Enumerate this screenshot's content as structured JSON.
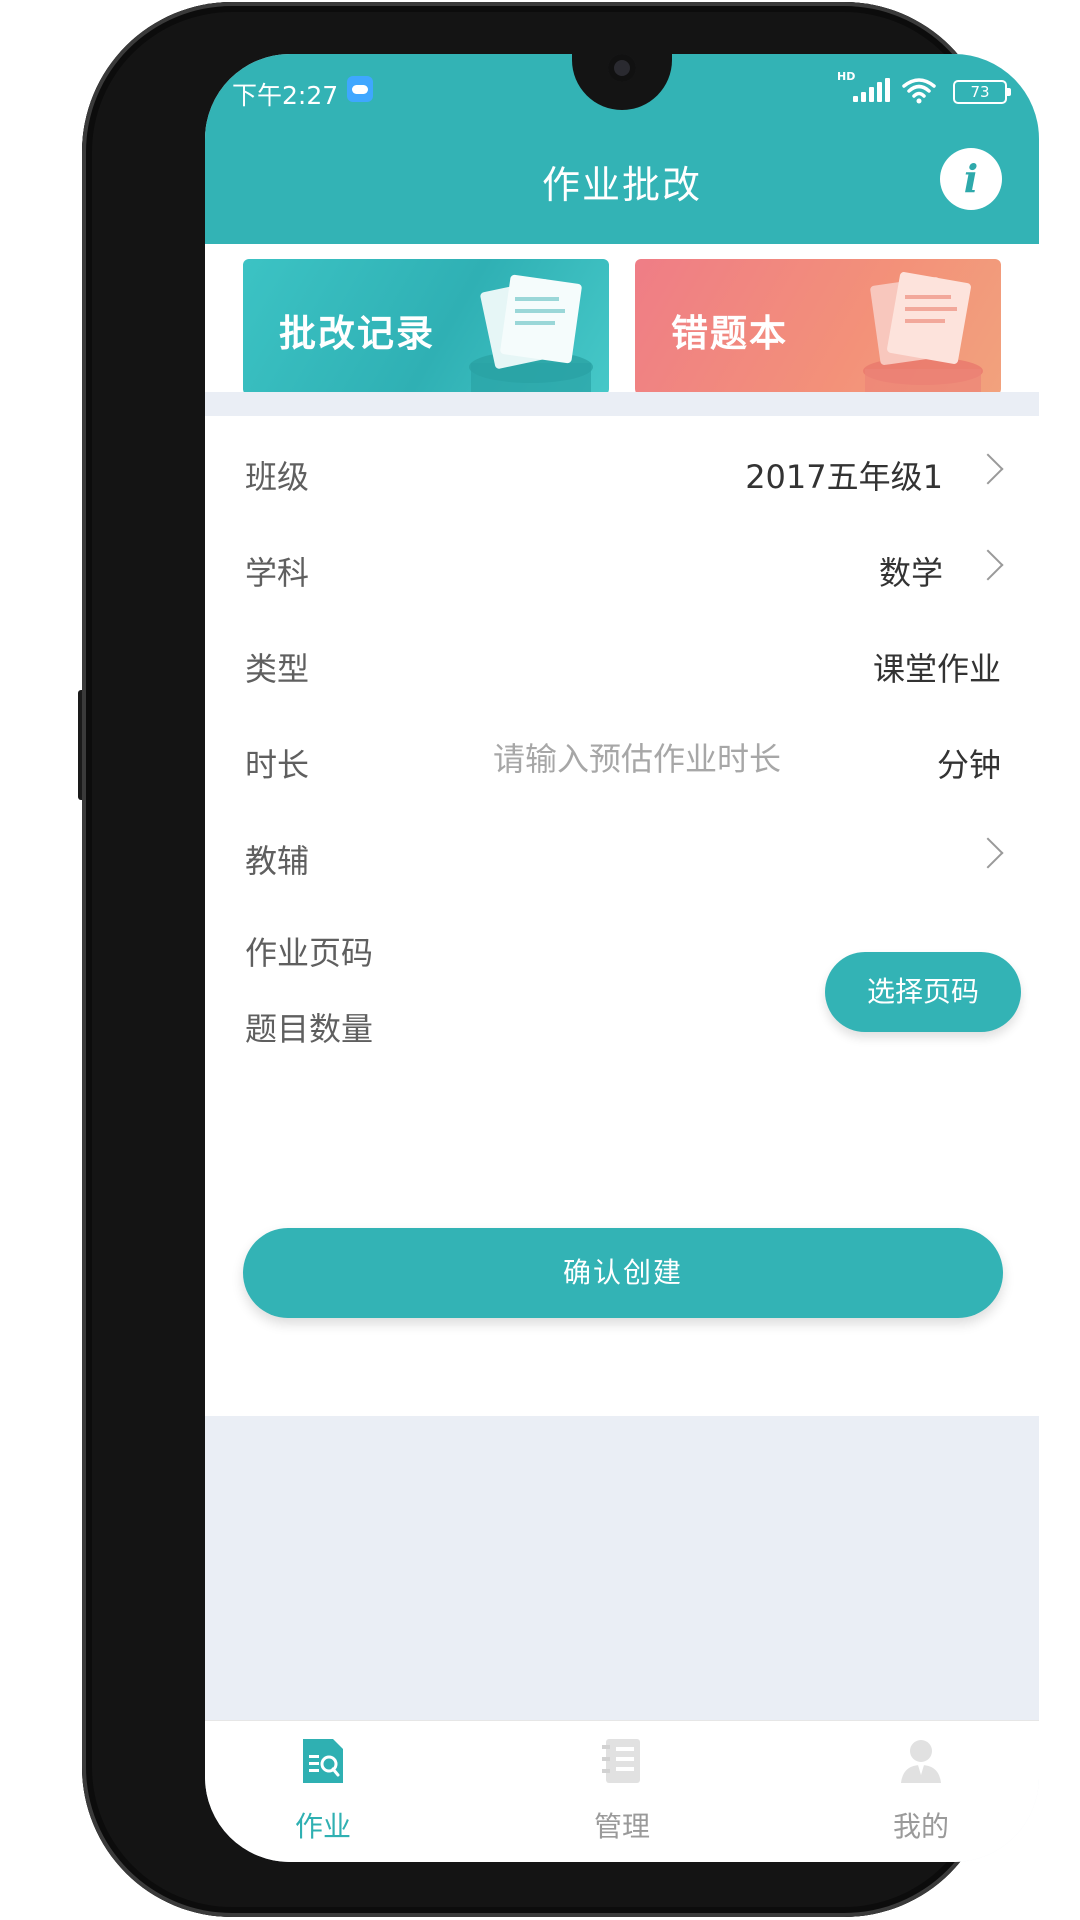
{
  "status_bar": {
    "time": "下午2:27",
    "battery": "73",
    "network_badge": "HD"
  },
  "header": {
    "title": "作业批改",
    "info_symbol": "i"
  },
  "banners": {
    "records_label": "批改记录",
    "mistakes_label": "错题本"
  },
  "form": {
    "class_label": "班级",
    "class_value": "2017五年级1",
    "subject_label": "学科",
    "subject_value": "数学",
    "type_label": "类型",
    "type_value": "课堂作业",
    "duration_label": "时长",
    "duration_placeholder": "请输入预估作业时长",
    "duration_value": "",
    "duration_unit": "分钟",
    "material_label": "教辅",
    "pages_label": "作业页码",
    "count_label": "题目数量",
    "select_pages_button": "选择页码",
    "confirm_button": "确认创建"
  },
  "tabbar": {
    "tabs": [
      {
        "label": "作业",
        "icon": "homework-icon",
        "active": true
      },
      {
        "label": "管理",
        "icon": "manage-icon",
        "active": false
      },
      {
        "label": "我的",
        "icon": "profile-icon",
        "active": false
      }
    ]
  },
  "colors": {
    "accent": "#33b3b5",
    "mistakes_card": "#f08a80",
    "background": "#eaeef5"
  }
}
